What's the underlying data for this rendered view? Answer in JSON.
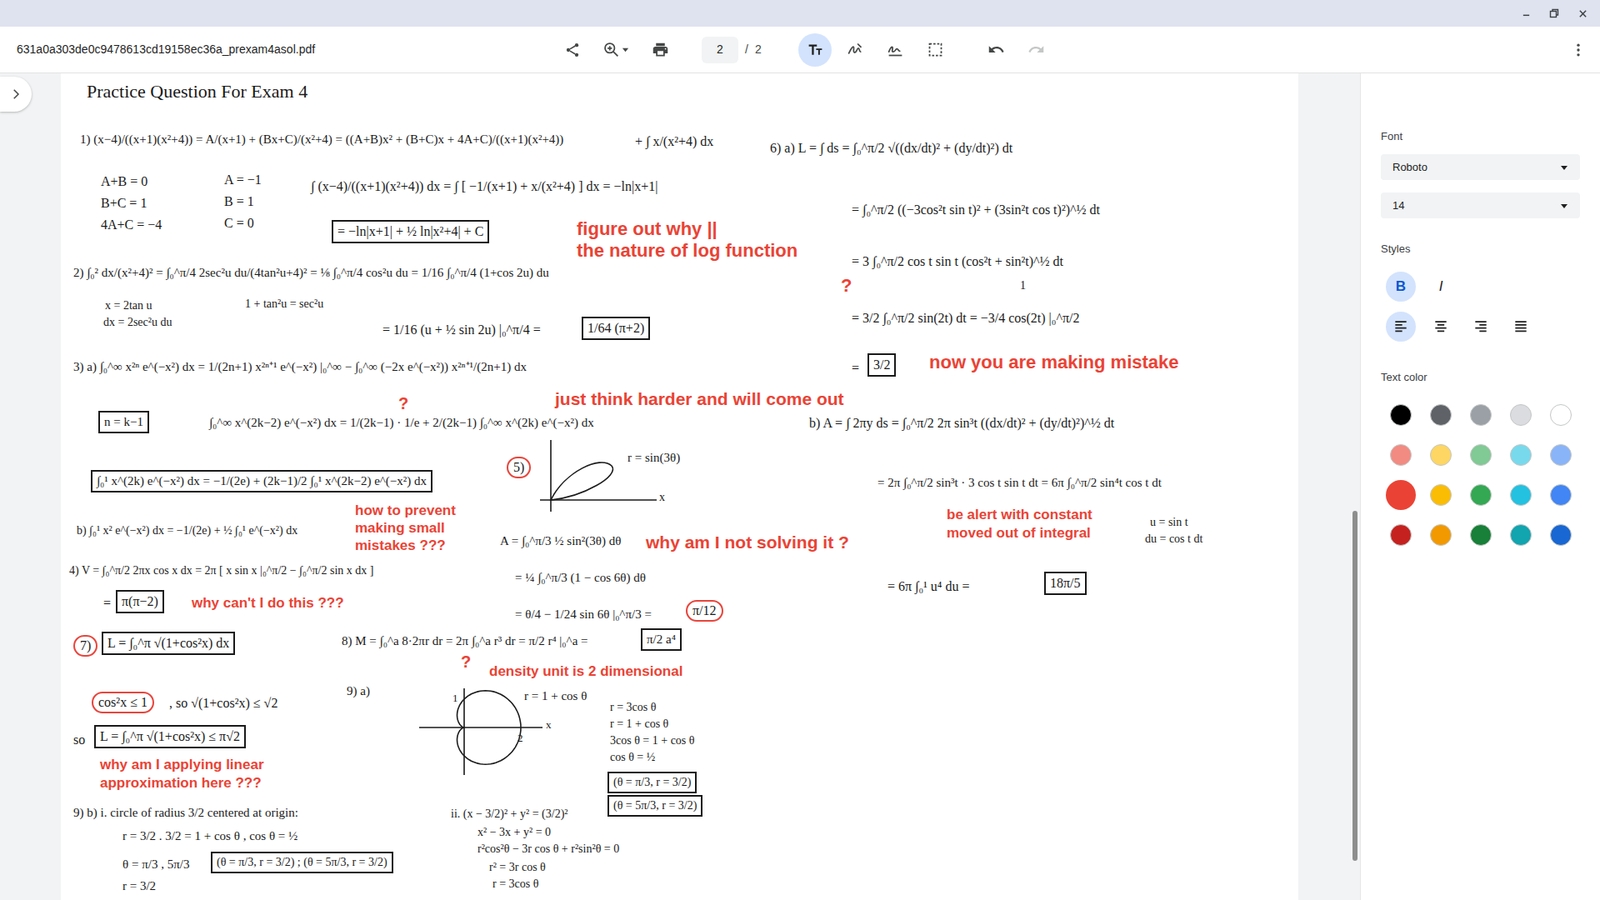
{
  "toolbar": {
    "filename": "631a0a303de0c9478613cd19158ec36a_prexam4asol.pdf",
    "page_current": "2",
    "page_separator": "/",
    "page_total": "2",
    "annotation_tools": [
      {
        "kind": "text",
        "selected": true
      },
      {
        "kind": "draw",
        "selected": false
      },
      {
        "kind": "sign",
        "selected": false
      },
      {
        "kind": "select",
        "selected": false
      }
    ],
    "history": [
      {
        "kind": "undo",
        "disabled": false
      },
      {
        "kind": "redo",
        "disabled": true
      }
    ]
  },
  "side_panel": {
    "font_label": "Font",
    "font": "Roboto",
    "size": "14",
    "styles_label": "Styles",
    "styles": [
      {
        "kind": "bold",
        "glyph": "B",
        "selected": true
      },
      {
        "kind": "italic",
        "glyph": "I",
        "selected": false
      }
    ],
    "alignment": [
      {
        "kind": "left",
        "selected": true
      },
      {
        "kind": "center",
        "selected": false
      },
      {
        "kind": "right",
        "selected": false
      },
      {
        "kind": "justify",
        "selected": false
      }
    ],
    "color_label": "Text color",
    "colors": [
      {
        "color": "#000000",
        "selected": false
      },
      {
        "color": "#5f6368",
        "selected": false
      },
      {
        "color": "#9aa0a6",
        "selected": false
      },
      {
        "color": "#dadce0",
        "selected": false
      },
      {
        "color": "#ffffff",
        "selected": false
      },
      {
        "color": "#f28b82",
        "selected": false
      },
      {
        "color": "#fdd663",
        "selected": false
      },
      {
        "color": "#81c995",
        "selected": false
      },
      {
        "color": "#78d9ec",
        "selected": false
      },
      {
        "color": "#8ab4f8",
        "selected": false
      },
      {
        "color": "#ea4335",
        "selected": true
      },
      {
        "color": "#fbbc04",
        "selected": false
      },
      {
        "color": "#34a853",
        "selected": false
      },
      {
        "color": "#24c1e0",
        "selected": false
      },
      {
        "color": "#4285f4",
        "selected": false
      },
      {
        "color": "#c5221f",
        "selected": false
      },
      {
        "color": "#f29900",
        "selected": false
      },
      {
        "color": "#188038",
        "selected": false
      },
      {
        "color": "#12a4af",
        "selected": false
      },
      {
        "color": "#1967d2",
        "selected": false
      }
    ]
  },
  "page": {
    "items": [
      {
        "text": "Practice Question For Exam 4",
        "kind": "plain"
      },
      {
        "text": "1) (x−4)/((x+1)(x²+4)) = A/(x+1) + (Bx+C)/(x²+4) = ((A+B)x² + (B+C)x + 4A+C)/((x+1)(x²+4))",
        "kind": "plain"
      },
      {
        "text": "+ ∫ x/(x²+4) dx",
        "kind": "plain"
      },
      {
        "text": "A+B = 0",
        "kind": "plain"
      },
      {
        "text": "B+C = 1",
        "kind": "plain"
      },
      {
        "text": "4A+C = −4",
        "kind": "plain"
      },
      {
        "text": "A = −1",
        "kind": "plain"
      },
      {
        "text": "B = 1",
        "kind": "plain"
      },
      {
        "text": "C = 0",
        "kind": "plain"
      },
      {
        "text": "∫ (x−4)/((x+1)(x²+4)) dx = ∫ [ −1/(x+1) + x/(x²+4) ] dx = −ln|x+1|",
        "kind": "plain"
      },
      {
        "text": "= −ln|x+1| + ½ ln|x²+4| + C",
        "kind": "boxed"
      },
      {
        "text": "2) ∫₀² dx/(x²+4)² = ∫₀^π/4 2sec²u du/(4tan²u+4)² = ⅛ ∫₀^π/4 cos²u du = 1/16 ∫₀^π/4 (1+cos 2u) du",
        "kind": "plain"
      },
      {
        "text": "x = 2tan u",
        "kind": "plain"
      },
      {
        "text": "dx = 2sec²u du",
        "kind": "plain"
      },
      {
        "text": "1 + tan²u = sec²u",
        "kind": "plain"
      },
      {
        "text": "= 1/16 (u + ½ sin 2u) |₀^π/4 =",
        "kind": "plain"
      },
      {
        "text": "1/64 (π+2)",
        "kind": "boxed"
      },
      {
        "text": "3) a) ∫₀^∞ x²ⁿ e^(−x²) dx = 1/(2n+1) x²ⁿ⁺¹ e^(−x²) |₀^∞ − ∫₀^∞ (−2x e^(−x²)) x²ⁿ⁺¹/(2n+1) dx",
        "kind": "plain"
      },
      {
        "text": "n = k−1",
        "kind": "boxed"
      },
      {
        "text": "∫₀^∞ x^(2k−2) e^(−x²) dx = 1/(2k−1) · 1/e + 2/(2k−1) ∫₀^∞ x^(2k) e^(−x²) dx",
        "kind": "plain"
      },
      {
        "text": "∫₀¹ x^(2k) e^(−x²) dx = −1/(2e) + (2k−1)/2 ∫₀¹ x^(2k−2) e^(−x²) dx",
        "kind": "boxed"
      },
      {
        "text": "b) ∫₀¹ x² e^(−x²) dx = −1/(2e) + ½ ∫₀¹ e^(−x²) dx",
        "kind": "plain"
      },
      {
        "text": "4) V = ∫₀^π/2 2πx cos x dx = 2π [ x sin x |₀^π/2 − ∫₀^π/2 sin x dx ]",
        "kind": "plain"
      },
      {
        "text": "=",
        "kind": "plain"
      },
      {
        "text": "π(π−2)",
        "kind": "boxed"
      },
      {
        "text": "7)",
        "kind": "circled"
      },
      {
        "text": "L = ∫₀^π √(1+cos²x) dx",
        "kind": "boxed"
      },
      {
        "text": "cos²x ≤ 1",
        "kind": "circled"
      },
      {
        "text": ", so √(1+cos²x) ≤ √2",
        "kind": "plain"
      },
      {
        "text": "so",
        "kind": "plain"
      },
      {
        "text": "L = ∫₀^π √(1+cos²x) ≤ π√2",
        "kind": "boxed"
      },
      {
        "text": "9) b)  i. circle of radius 3/2 centered at origin:",
        "kind": "plain"
      },
      {
        "text": "r = 3/2 .   3/2 = 1 + cos θ ,  cos θ = ½",
        "kind": "plain"
      },
      {
        "text": "θ = π/3 , 5π/3",
        "kind": "plain"
      },
      {
        "text": "(θ = π/3, r = 3/2) ; (θ = 5π/3, r = 3/2)",
        "kind": "boxed"
      },
      {
        "text": "r = 3/2",
        "kind": "plain"
      },
      {
        "text": "5)",
        "kind": "circled"
      },
      {
        "text": "r = sin(3θ)",
        "kind": "plain"
      },
      {
        "text": "x",
        "kind": "plain"
      },
      {
        "text": "A = ∫₀^π/3 ½ sin²(3θ) dθ",
        "kind": "plain"
      },
      {
        "text": "= ¼ ∫₀^π/3 (1 − cos 6θ) dθ",
        "kind": "plain"
      },
      {
        "text": "= θ/4 − 1/24 sin 6θ |₀^π/3 =",
        "kind": "plain"
      },
      {
        "text": "π/12",
        "kind": "circled"
      },
      {
        "text": "8)  M = ∫₀^a 8·2πr dr = 2π ∫₀^a r³ dr = π/2 r⁴ |₀^a =",
        "kind": "plain"
      },
      {
        "text": "π/2 a⁴",
        "kind": "boxed"
      },
      {
        "text": "9) a)",
        "kind": "plain"
      },
      {
        "text": "r = 1 + cos θ",
        "kind": "plain"
      },
      {
        "text": "1",
        "kind": "plain"
      },
      {
        "text": "2",
        "kind": "plain"
      },
      {
        "text": "x",
        "kind": "plain"
      },
      {
        "text": "r = 3cos θ",
        "kind": "plain"
      },
      {
        "text": "r = 1 + cos θ",
        "kind": "plain"
      },
      {
        "text": "3cos θ = 1 + cos θ",
        "kind": "plain"
      },
      {
        "text": "cos θ = ½",
        "kind": "plain"
      },
      {
        "text": "(θ = π/3, r = 3/2)",
        "kind": "boxed"
      },
      {
        "text": "(θ = 5π/3, r = 3/2)",
        "kind": "boxed"
      },
      {
        "text": "ii. (x − 3/2)² + y² = (3/2)²",
        "kind": "plain"
      },
      {
        "text": "x² − 3x + y² = 0",
        "kind": "plain"
      },
      {
        "text": "r²cos²θ − 3r cos θ + r²sin²θ = 0",
        "kind": "plain"
      },
      {
        "text": "r² = 3r cos θ",
        "kind": "plain"
      },
      {
        "text": "r = 3cos θ",
        "kind": "plain"
      },
      {
        "text": "6) a)  L = ∫ ds = ∫₀^π/2 √((dx/dt)² + (dy/dt)²) dt",
        "kind": "plain"
      },
      {
        "text": "= ∫₀^π/2 ((−3cos²t sin t)² + (3sin²t cos t)²)^½ dt",
        "kind": "plain"
      },
      {
        "text": "= 3 ∫₀^π/2 cos t sin t (cos²t + sin²t)^½ dt",
        "kind": "plain"
      },
      {
        "text": "1",
        "kind": "plain"
      },
      {
        "text": "= 3/2 ∫₀^π/2 sin(2t) dt = −3/4 cos(2t) |₀^π/2",
        "kind": "plain"
      },
      {
        "text": "=",
        "kind": "plain"
      },
      {
        "text": "3/2",
        "kind": "boxed"
      },
      {
        "text": "b) A = ∫ 2πy ds = ∫₀^π/2 2π sin³t ((dx/dt)² + (dy/dt)²)^½ dt",
        "kind": "plain"
      },
      {
        "text": "= 2π ∫₀^π/2 sin³t · 3 cos t sin t dt = 6π ∫₀^π/2 sin⁴t cos t dt",
        "kind": "plain"
      },
      {
        "text": "u = sin t",
        "kind": "plain"
      },
      {
        "text": "du = cos t dt",
        "kind": "plain"
      },
      {
        "text": "= 6π ∫₀¹ u⁴ du =",
        "kind": "plain"
      },
      {
        "text": "18π/5",
        "kind": "boxed"
      }
    ],
    "notes": [
      "figure out why ||",
      "the nature of log function",
      "?",
      "now you are making mistake",
      "just think harder and will come out",
      "?",
      "how to prevent",
      "making small",
      "mistakes ???",
      "why am I not solving it ?",
      "be alert with constant",
      "moved out of integral",
      "why can't I do this ???",
      "?",
      "density unit is 2 dimensional",
      "why am I applying linear",
      "approximation here ???"
    ]
  }
}
